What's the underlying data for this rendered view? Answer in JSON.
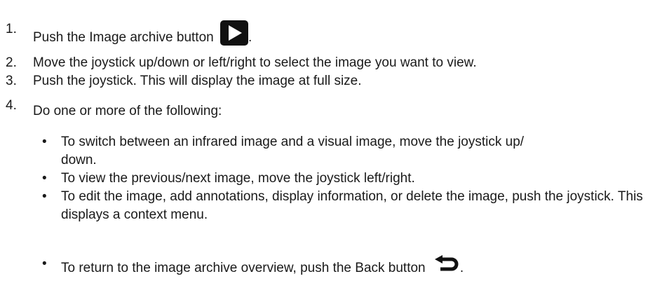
{
  "steps": [
    {
      "num": "1.",
      "text": "Push the Image archive button",
      "suffix": ".",
      "icon": "play-icon"
    },
    {
      "num": "2.",
      "text": "Move the joystick up/down or left/right to select the image you want to view."
    },
    {
      "num": "3.",
      "text": "Push the joystick. This will display the image at full size."
    },
    {
      "num": "4.",
      "text": "Do one or more of the following:"
    }
  ],
  "bullets": [
    {
      "text": "To switch between an infrared image and a visual image, move the joystick up/ down."
    },
    {
      "text": "To view the previous/next image, move the joystick left/right."
    },
    {
      "text": "To edit the image, add annotations, display information, or delete the image, push the joystick. This displays a context menu."
    },
    {
      "text": "To return to the image archive overview, push the Back button",
      "suffix": ".",
      "icon": "back-arrow-icon"
    }
  ],
  "bullet_symbol": "•"
}
